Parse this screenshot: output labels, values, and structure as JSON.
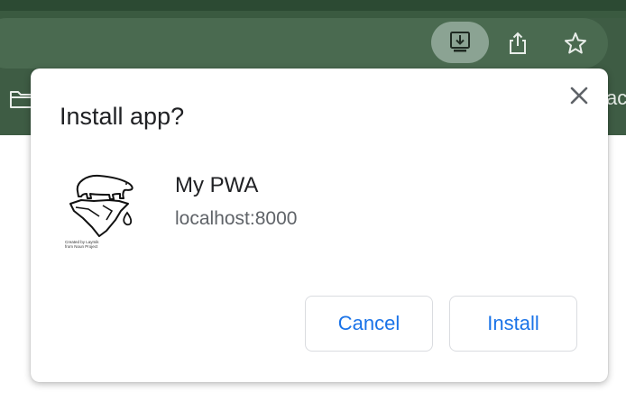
{
  "browser": {
    "bookmark_overflow_text": "act",
    "toolbar_icons": [
      "install-app-icon",
      "share-icon",
      "bookmark-star-icon"
    ],
    "folder_icon": "folder-icon"
  },
  "dialog": {
    "title": "Install app?",
    "app": {
      "name": "My PWA",
      "origin": "localhost:8000",
      "icon": "polar-bear-on-iceberg",
      "icon_credit_line1": "Created by Laymik",
      "icon_credit_line2": "from Noun Project"
    },
    "buttons": {
      "cancel": "Cancel",
      "install": "Install"
    },
    "close_icon": "close-icon"
  },
  "colors": {
    "browser_chrome": "#3e5c44",
    "accent_blue": "#1a73e8",
    "active_icon_bg": "#8ba393"
  }
}
